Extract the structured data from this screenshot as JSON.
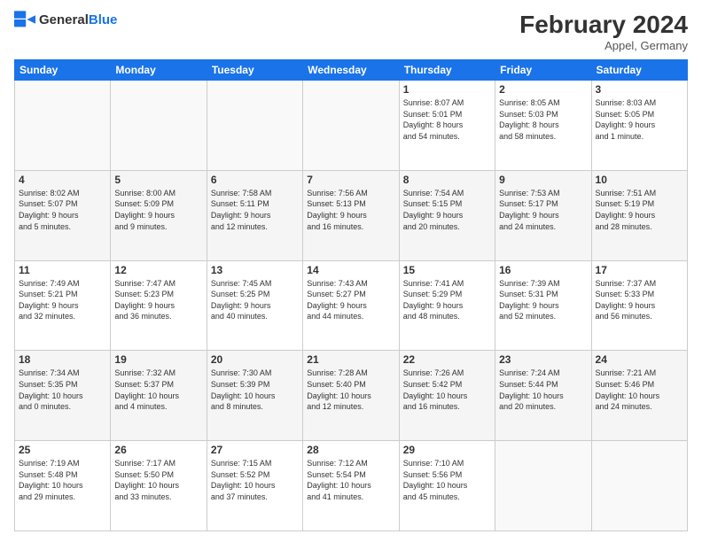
{
  "header": {
    "logo_line1": "General",
    "logo_line2": "Blue",
    "month_title": "February 2024",
    "location": "Appel, Germany"
  },
  "days_of_week": [
    "Sunday",
    "Monday",
    "Tuesday",
    "Wednesday",
    "Thursday",
    "Friday",
    "Saturday"
  ],
  "weeks": [
    [
      {
        "day": "",
        "info": ""
      },
      {
        "day": "",
        "info": ""
      },
      {
        "day": "",
        "info": ""
      },
      {
        "day": "",
        "info": ""
      },
      {
        "day": "1",
        "info": "Sunrise: 8:07 AM\nSunset: 5:01 PM\nDaylight: 8 hours\nand 54 minutes."
      },
      {
        "day": "2",
        "info": "Sunrise: 8:05 AM\nSunset: 5:03 PM\nDaylight: 8 hours\nand 58 minutes."
      },
      {
        "day": "3",
        "info": "Sunrise: 8:03 AM\nSunset: 5:05 PM\nDaylight: 9 hours\nand 1 minute."
      }
    ],
    [
      {
        "day": "4",
        "info": "Sunrise: 8:02 AM\nSunset: 5:07 PM\nDaylight: 9 hours\nand 5 minutes."
      },
      {
        "day": "5",
        "info": "Sunrise: 8:00 AM\nSunset: 5:09 PM\nDaylight: 9 hours\nand 9 minutes."
      },
      {
        "day": "6",
        "info": "Sunrise: 7:58 AM\nSunset: 5:11 PM\nDaylight: 9 hours\nand 12 minutes."
      },
      {
        "day": "7",
        "info": "Sunrise: 7:56 AM\nSunset: 5:13 PM\nDaylight: 9 hours\nand 16 minutes."
      },
      {
        "day": "8",
        "info": "Sunrise: 7:54 AM\nSunset: 5:15 PM\nDaylight: 9 hours\nand 20 minutes."
      },
      {
        "day": "9",
        "info": "Sunrise: 7:53 AM\nSunset: 5:17 PM\nDaylight: 9 hours\nand 24 minutes."
      },
      {
        "day": "10",
        "info": "Sunrise: 7:51 AM\nSunset: 5:19 PM\nDaylight: 9 hours\nand 28 minutes."
      }
    ],
    [
      {
        "day": "11",
        "info": "Sunrise: 7:49 AM\nSunset: 5:21 PM\nDaylight: 9 hours\nand 32 minutes."
      },
      {
        "day": "12",
        "info": "Sunrise: 7:47 AM\nSunset: 5:23 PM\nDaylight: 9 hours\nand 36 minutes."
      },
      {
        "day": "13",
        "info": "Sunrise: 7:45 AM\nSunset: 5:25 PM\nDaylight: 9 hours\nand 40 minutes."
      },
      {
        "day": "14",
        "info": "Sunrise: 7:43 AM\nSunset: 5:27 PM\nDaylight: 9 hours\nand 44 minutes."
      },
      {
        "day": "15",
        "info": "Sunrise: 7:41 AM\nSunset: 5:29 PM\nDaylight: 9 hours\nand 48 minutes."
      },
      {
        "day": "16",
        "info": "Sunrise: 7:39 AM\nSunset: 5:31 PM\nDaylight: 9 hours\nand 52 minutes."
      },
      {
        "day": "17",
        "info": "Sunrise: 7:37 AM\nSunset: 5:33 PM\nDaylight: 9 hours\nand 56 minutes."
      }
    ],
    [
      {
        "day": "18",
        "info": "Sunrise: 7:34 AM\nSunset: 5:35 PM\nDaylight: 10 hours\nand 0 minutes."
      },
      {
        "day": "19",
        "info": "Sunrise: 7:32 AM\nSunset: 5:37 PM\nDaylight: 10 hours\nand 4 minutes."
      },
      {
        "day": "20",
        "info": "Sunrise: 7:30 AM\nSunset: 5:39 PM\nDaylight: 10 hours\nand 8 minutes."
      },
      {
        "day": "21",
        "info": "Sunrise: 7:28 AM\nSunset: 5:40 PM\nDaylight: 10 hours\nand 12 minutes."
      },
      {
        "day": "22",
        "info": "Sunrise: 7:26 AM\nSunset: 5:42 PM\nDaylight: 10 hours\nand 16 minutes."
      },
      {
        "day": "23",
        "info": "Sunrise: 7:24 AM\nSunset: 5:44 PM\nDaylight: 10 hours\nand 20 minutes."
      },
      {
        "day": "24",
        "info": "Sunrise: 7:21 AM\nSunset: 5:46 PM\nDaylight: 10 hours\nand 24 minutes."
      }
    ],
    [
      {
        "day": "25",
        "info": "Sunrise: 7:19 AM\nSunset: 5:48 PM\nDaylight: 10 hours\nand 29 minutes."
      },
      {
        "day": "26",
        "info": "Sunrise: 7:17 AM\nSunset: 5:50 PM\nDaylight: 10 hours\nand 33 minutes."
      },
      {
        "day": "27",
        "info": "Sunrise: 7:15 AM\nSunset: 5:52 PM\nDaylight: 10 hours\nand 37 minutes."
      },
      {
        "day": "28",
        "info": "Sunrise: 7:12 AM\nSunset: 5:54 PM\nDaylight: 10 hours\nand 41 minutes."
      },
      {
        "day": "29",
        "info": "Sunrise: 7:10 AM\nSunset: 5:56 PM\nDaylight: 10 hours\nand 45 minutes."
      },
      {
        "day": "",
        "info": ""
      },
      {
        "day": "",
        "info": ""
      }
    ]
  ]
}
